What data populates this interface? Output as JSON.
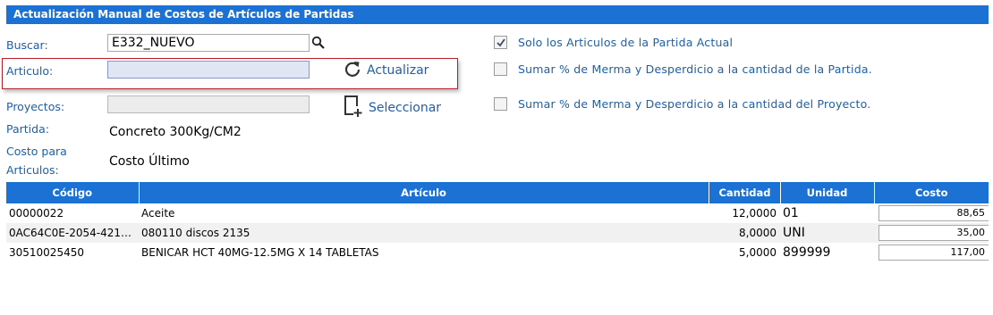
{
  "header": {
    "title": "Actualización Manual de Costos de Artículos de Partidas"
  },
  "form": {
    "buscar_label": "Buscar:",
    "buscar_value": "E332_NUEVO",
    "articulo_label": "Articulo:",
    "articulo_value": "",
    "proyectos_label": "Proyectos:",
    "proyectos_value": "",
    "partida_label": "Partida:",
    "partida_value": "Concreto 300Kg/CM2",
    "costo_label_1": "Costo para",
    "costo_label_2": "Articulos:",
    "costo_value": "Costo Último",
    "actualizar_label": "Actualizar",
    "seleccionar_label": "Seleccionar"
  },
  "options": [
    {
      "label": "Solo los Articulos de la Partida Actual",
      "checked": true
    },
    {
      "label": "Sumar % de Merma y Desperdicio a la cantidad de la Partida.",
      "checked": false
    },
    {
      "label": "Sumar % de Merma y Desperdicio a la cantidad del Proyecto.",
      "checked": false
    }
  ],
  "table": {
    "headers": [
      "Código",
      "Artículo",
      "Cantidad",
      "Unidad",
      "Costo"
    ],
    "rows": [
      {
        "codigo": "00000022",
        "articulo": "Aceite",
        "cantidad": "12,0000",
        "unidad": "01",
        "costo": "88,65"
      },
      {
        "codigo": "0AC64C0E-2054-421…",
        "articulo": "080110 discos 2135",
        "cantidad": "8,0000",
        "unidad": "UNI",
        "costo": "35,00"
      },
      {
        "codigo": "30510025450",
        "articulo": "BENICAR HCT 40MG-12.5MG X 14 TABLETAS",
        "cantidad": "5,0000",
        "unidad": "899999",
        "costo": "117,00"
      }
    ]
  },
  "colors": {
    "header_blue": "#1c72d4",
    "label_blue": "#1d5fa8",
    "highlight_red": "#b51f25"
  }
}
